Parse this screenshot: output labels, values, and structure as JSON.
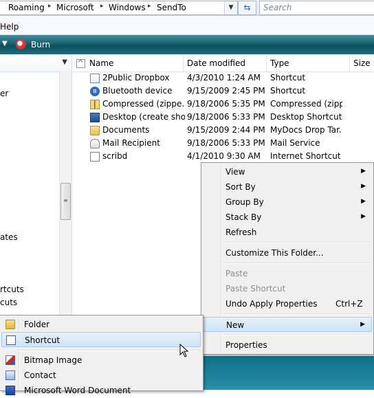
{
  "address": {
    "crumbs": [
      "Roaming",
      "Microsoft",
      "Windows",
      "SendTo"
    ],
    "separator": "▸",
    "search_placeholder": "Search",
    "refresh_icon": "refresh-icon"
  },
  "menubar": {
    "help": "Help"
  },
  "commandbar": {
    "burn": "Burn"
  },
  "nav": {
    "items": [
      "er",
      "ates",
      "rtcuts",
      "cuts"
    ]
  },
  "columns": {
    "name": "Name",
    "date": "Date modified",
    "type": "Type",
    "size": "Size"
  },
  "files": [
    {
      "name": "2Public Dropbox",
      "date": "4/3/2010 1:24 AM",
      "type": "Shortcut",
      "icon": "shortcut-icon"
    },
    {
      "name": "Bluetooth device",
      "date": "9/15/2009 2:45 PM",
      "type": "Shortcut",
      "icon": "bluetooth-icon"
    },
    {
      "name": "Compressed (zippe...",
      "date": "9/18/2006 5:35 PM",
      "type": "Compressed (zipp...",
      "icon": "zip-folder-icon"
    },
    {
      "name": "Desktop (create sho...",
      "date": "9/18/2006 5:33 PM",
      "type": "Desktop Shortcut",
      "icon": "desktop-icon"
    },
    {
      "name": "Documents",
      "date": "9/15/2009 2:44 PM",
      "type": "MyDocs Drop Tar...",
      "icon": "documents-icon"
    },
    {
      "name": "Mail Recipient",
      "date": "9/18/2006 5:33 PM",
      "type": "Mail Service",
      "icon": "mail-icon"
    },
    {
      "name": "scribd",
      "date": "4/1/2010 9:30 AM",
      "type": "Internet Shortcut",
      "icon": "internet-shortcut-icon"
    }
  ],
  "context_menu": {
    "view": "View",
    "sort_by": "Sort By",
    "group_by": "Group By",
    "stack_by": "Stack By",
    "refresh": "Refresh",
    "customize": "Customize This Folder...",
    "paste": "Paste",
    "paste_shortcut": "Paste Shortcut",
    "undo": "Undo Apply Properties",
    "undo_shortcut": "Ctrl+Z",
    "new": "New",
    "properties": "Properties",
    "submenu_arrow": "▶"
  },
  "new_submenu": {
    "folder": "Folder",
    "shortcut": "Shortcut",
    "bitmap": "Bitmap Image",
    "contact": "Contact",
    "word": "Microsoft Word Document"
  }
}
